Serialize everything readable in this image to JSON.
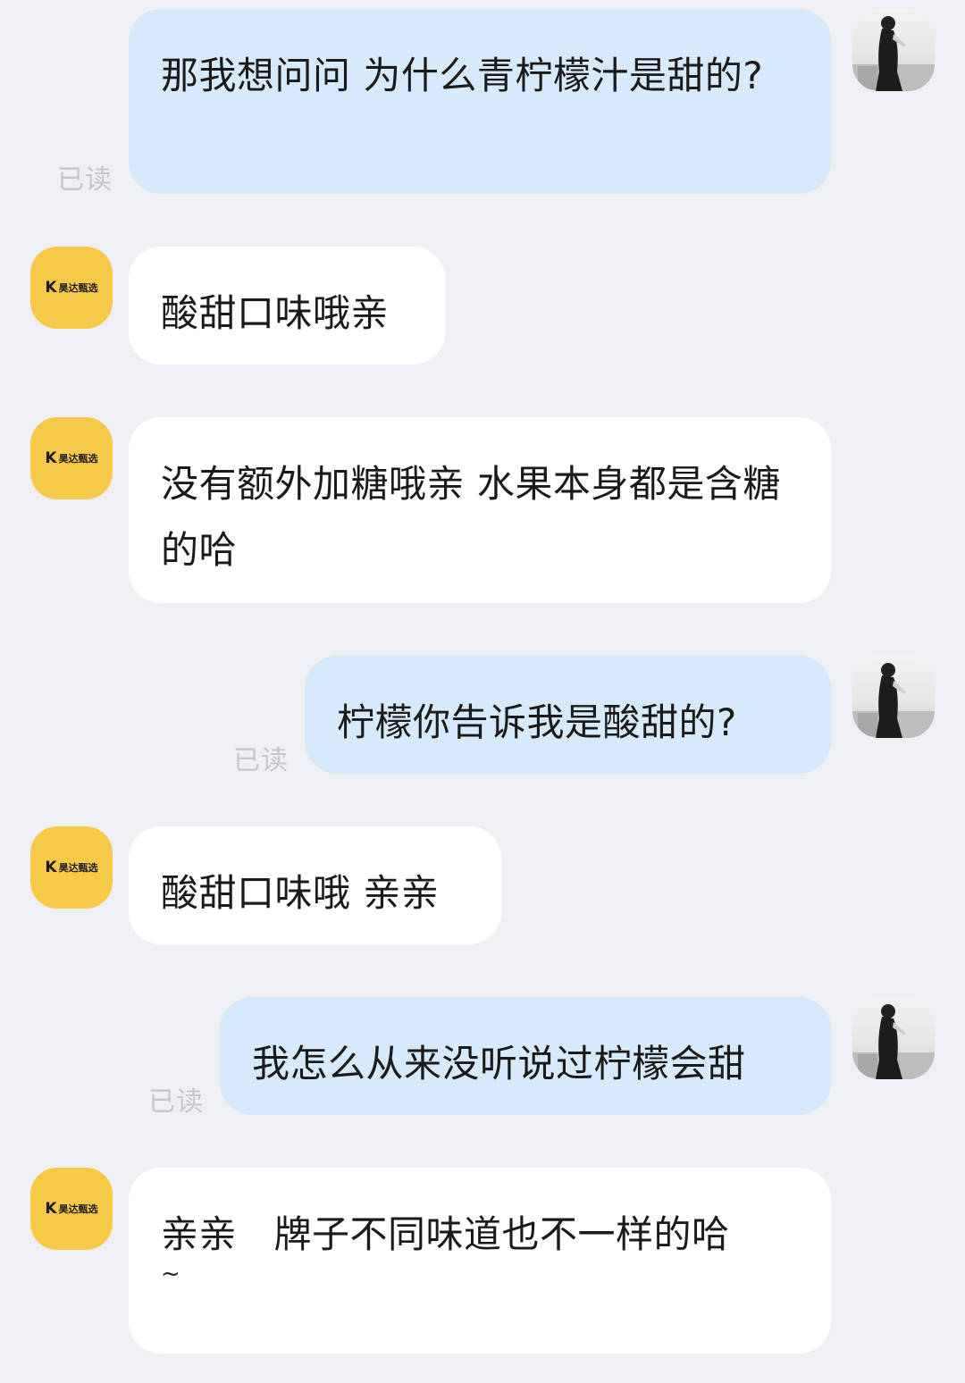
{
  "chat": {
    "read_label": "已读",
    "shop_logo": {
      "mark": "K",
      "name": "昊达甄选"
    },
    "messages": [
      {
        "side": "out",
        "text": "那我想问问 为什么青柠檬汁是甜的?",
        "read": "已读"
      },
      {
        "side": "in",
        "text": "酸甜口味哦亲"
      },
      {
        "side": "in",
        "text": "没有额外加糖哦亲 水果本身都是含糖的哈"
      },
      {
        "side": "out",
        "text": "柠檬你告诉我是酸甜的?",
        "read": "已读"
      },
      {
        "side": "in",
        "text": "酸甜口味哦 亲亲"
      },
      {
        "side": "out",
        "text": "我怎么从来没听说过柠檬会甜",
        "read": "已读"
      },
      {
        "side": "in",
        "text": "亲亲   牌子不同味道也不一样的哈",
        "tail": "~"
      }
    ]
  },
  "colors": {
    "background": "#eef0f4",
    "outgoing_bubble": "#d6eafb",
    "incoming_bubble": "#ffffff",
    "shop_avatar": "#f7c948",
    "read_text": "#c3c6cb"
  },
  "icons": {
    "user_avatar": "user-avatar-photo",
    "shop_avatar": "shop-logo-avatar"
  }
}
